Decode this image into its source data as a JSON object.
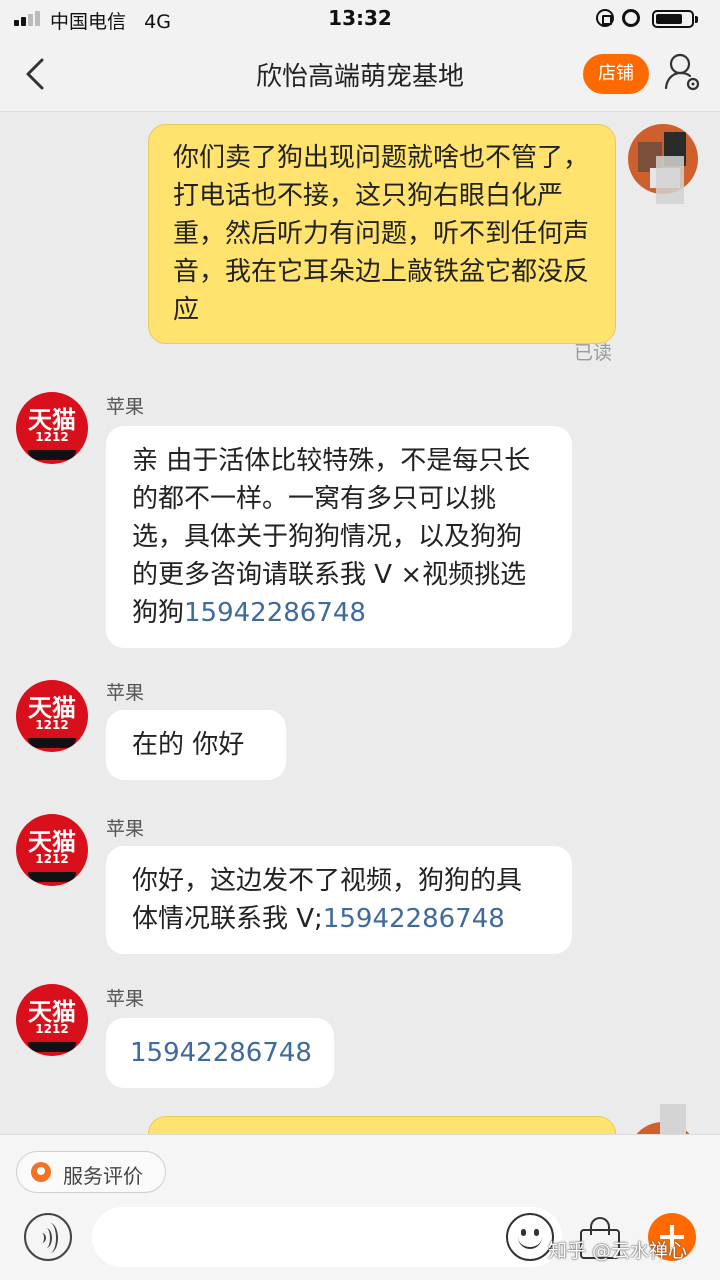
{
  "status_bar": {
    "carrier": "中国电信",
    "network": "4G",
    "time": "13:32"
  },
  "header": {
    "title": "欣怡高端萌宠基地",
    "store_label": "店铺"
  },
  "messages": {
    "m1": {
      "text": "你们卖了狗出现问题就啥也不管了，打电话也不接，这只狗右眼白化严重，然后听力有问题，听不到任何声音，我在它耳朵边上敲铁盆它都没反应",
      "status": "已读"
    },
    "m2": {
      "sender": "苹果",
      "avatar_text": "天猫",
      "avatar_sub": "1212",
      "text": "亲  由于活体比较特殊，不是每只长的都不一样。一窝有多只可以挑选，具体关于狗狗情况，以及狗狗的更多咨询请联系我 V ×视频挑选狗狗",
      "phone": "15942286748"
    },
    "m3": {
      "sender": "苹果",
      "avatar_text": "天猫",
      "avatar_sub": "1212",
      "text": "在的  你好"
    },
    "m4": {
      "sender": "苹果",
      "avatar_text": "天猫",
      "avatar_sub": "1212",
      "text": "你好，这边发不了视频，狗狗的具体情况联系我 V;",
      "phone": "15942286748"
    },
    "m5": {
      "sender": "苹果",
      "avatar_text": "天猫",
      "avatar_sub": "1212",
      "phone": "15942286748"
    }
  },
  "bottom_bar": {
    "service_label": "服务评价",
    "input_placeholder": ""
  },
  "watermark": "知乎 @云水禅心",
  "colors": {
    "accent": "#ff6a00",
    "my_bubble": "#ffe36e",
    "link": "#3e6a9c",
    "tmall_red": "#d9101c"
  }
}
